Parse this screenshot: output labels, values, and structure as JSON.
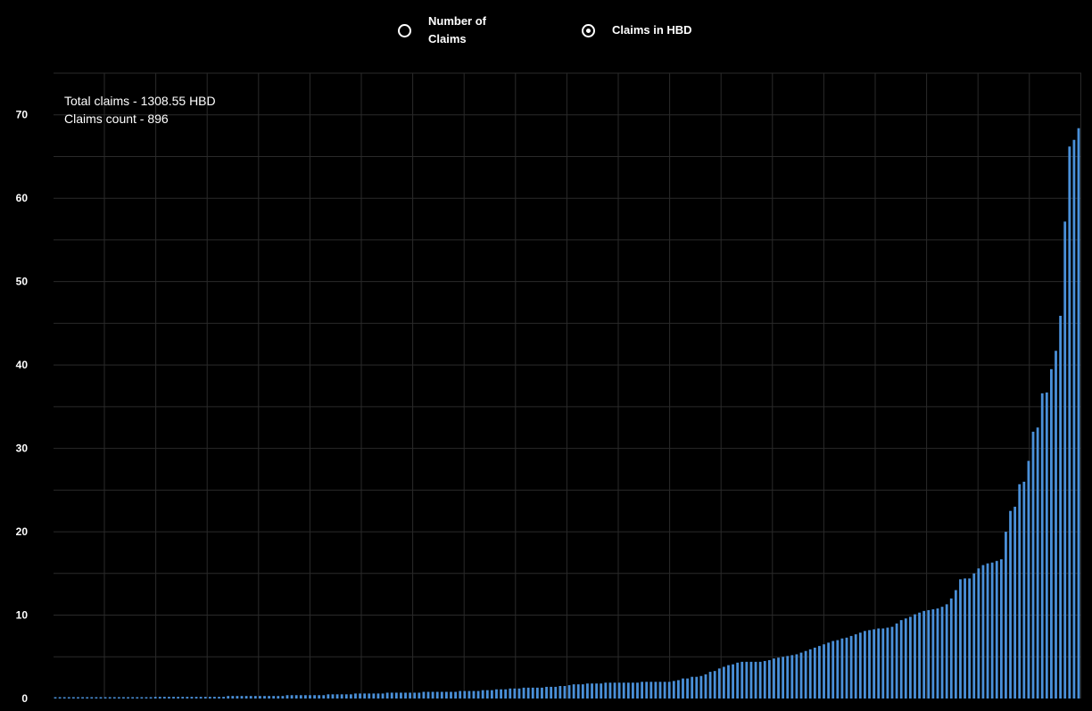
{
  "legend": {
    "options": [
      {
        "label_line1": "Number of",
        "label_line2": "Claims",
        "selected": false
      },
      {
        "label_line1": "Claims in HBD",
        "label_line2": "",
        "selected": true
      }
    ]
  },
  "summary": {
    "total_claims": "Total claims - 1308.55 HBD",
    "claims_count": "Claims count - 896"
  },
  "colors": {
    "background": "#000000",
    "bar": "#4a90d9",
    "grid": "#2a2a2a",
    "text": "#ffffff"
  },
  "chart_data": {
    "type": "bar",
    "title": "",
    "xlabel": "",
    "ylabel": "",
    "ylim": [
      0,
      75
    ],
    "yticks": [
      0,
      10,
      20,
      30,
      40,
      50,
      60,
      70
    ],
    "grid": true,
    "legend_position": "top-center",
    "values": [
      0.1,
      0.1,
      0.1,
      0.1,
      0.1,
      0.1,
      0.1,
      0.1,
      0.1,
      0.1,
      0.1,
      0.1,
      0.1,
      0.1,
      0.1,
      0.1,
      0.1,
      0.1,
      0.1,
      0.1,
      0.1,
      0.1,
      0.2,
      0.2,
      0.2,
      0.2,
      0.2,
      0.2,
      0.2,
      0.2,
      0.2,
      0.2,
      0.2,
      0.2,
      0.2,
      0.2,
      0.2,
      0.2,
      0.3,
      0.3,
      0.3,
      0.3,
      0.3,
      0.3,
      0.3,
      0.3,
      0.3,
      0.3,
      0.3,
      0.3,
      0.3,
      0.4,
      0.4,
      0.4,
      0.4,
      0.4,
      0.4,
      0.4,
      0.4,
      0.4,
      0.5,
      0.5,
      0.5,
      0.5,
      0.5,
      0.5,
      0.6,
      0.6,
      0.6,
      0.6,
      0.6,
      0.6,
      0.6,
      0.7,
      0.7,
      0.7,
      0.7,
      0.7,
      0.7,
      0.7,
      0.7,
      0.8,
      0.8,
      0.8,
      0.8,
      0.8,
      0.8,
      0.8,
      0.8,
      0.9,
      0.9,
      0.9,
      0.9,
      0.9,
      1.0,
      1.0,
      1.0,
      1.1,
      1.1,
      1.1,
      1.2,
      1.2,
      1.2,
      1.3,
      1.3,
      1.3,
      1.3,
      1.3,
      1.4,
      1.4,
      1.4,
      1.5,
      1.5,
      1.6,
      1.7,
      1.7,
      1.7,
      1.8,
      1.8,
      1.8,
      1.8,
      1.9,
      1.9,
      1.9,
      1.9,
      1.9,
      1.9,
      1.9,
      1.9,
      2.0,
      2.0,
      2.0,
      2.0,
      2.0,
      2.0,
      2.0,
      2.1,
      2.2,
      2.4,
      2.4,
      2.6,
      2.6,
      2.7,
      2.9,
      3.2,
      3.3,
      3.6,
      3.8,
      4.0,
      4.1,
      4.3,
      4.4,
      4.4,
      4.4,
      4.4,
      4.4,
      4.5,
      4.6,
      4.8,
      4.9,
      5.0,
      5.1,
      5.2,
      5.3,
      5.5,
      5.7,
      5.9,
      6.1,
      6.3,
      6.5,
      6.7,
      6.9,
      7.0,
      7.2,
      7.3,
      7.5,
      7.7,
      7.9,
      8.1,
      8.2,
      8.3,
      8.4,
      8.4,
      8.5,
      8.6,
      9.0,
      9.4,
      9.6,
      9.8,
      10.1,
      10.3,
      10.5,
      10.6,
      10.7,
      10.8,
      11.0,
      11.3,
      12.0,
      13.0,
      14.3,
      14.4,
      14.4,
      15.0,
      15.6,
      16.0,
      16.2,
      16.3,
      16.5,
      16.7,
      20.0,
      22.5,
      23.0,
      25.7,
      26.0,
      28.5,
      32.0,
      32.5,
      36.6,
      36.7,
      39.5,
      41.7,
      45.9,
      57.2,
      66.2,
      67.0,
      68.4
    ]
  }
}
